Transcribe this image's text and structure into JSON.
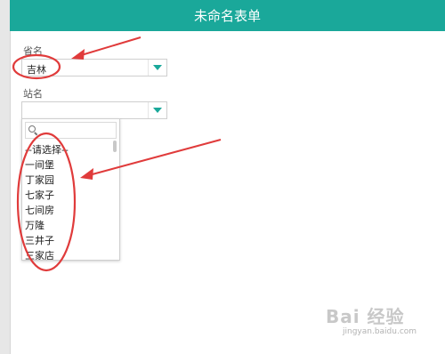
{
  "header": {
    "title": "未命名表单"
  },
  "form": {
    "province": {
      "label": "省名",
      "value": "吉林"
    },
    "station": {
      "label": "站名",
      "value": ""
    }
  },
  "dropdown": {
    "search_value": "",
    "options": [
      "--请选择--",
      "一间堡",
      "丁家园",
      "七家子",
      "七间房",
      "万隆",
      "三井子",
      "三家店"
    ]
  },
  "watermark": {
    "brand": "Bai 经验",
    "url": "jingyan.baidu.com"
  },
  "colors": {
    "accent": "#1aa89a",
    "annotation": "#e03b3b"
  }
}
